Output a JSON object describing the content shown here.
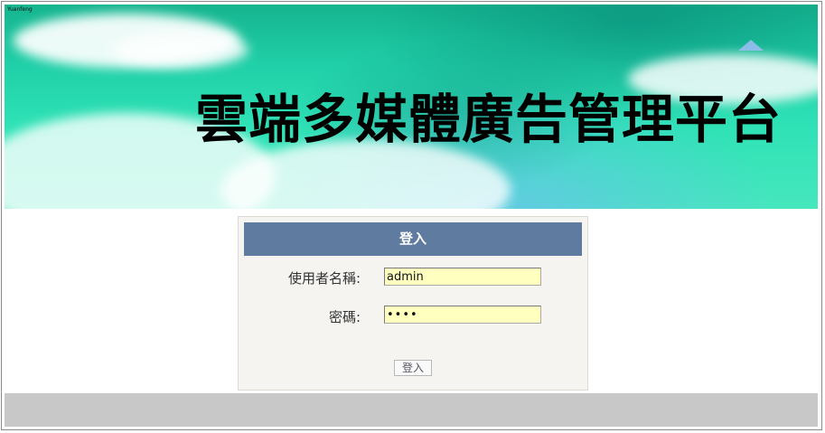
{
  "banner": {
    "title": "雲端多媒體廣告管理平台",
    "logo_text": "Yuanfeng"
  },
  "login": {
    "header": "登入",
    "username_label": "使用者名稱:",
    "username_value": "admin",
    "password_label": "密碼:",
    "password_value": "••••",
    "submit_label": "登入"
  },
  "colors": {
    "header_bg": "#5f7b9f",
    "input_bg": "#ffffc0",
    "footer_bg": "#c8c8c8"
  }
}
